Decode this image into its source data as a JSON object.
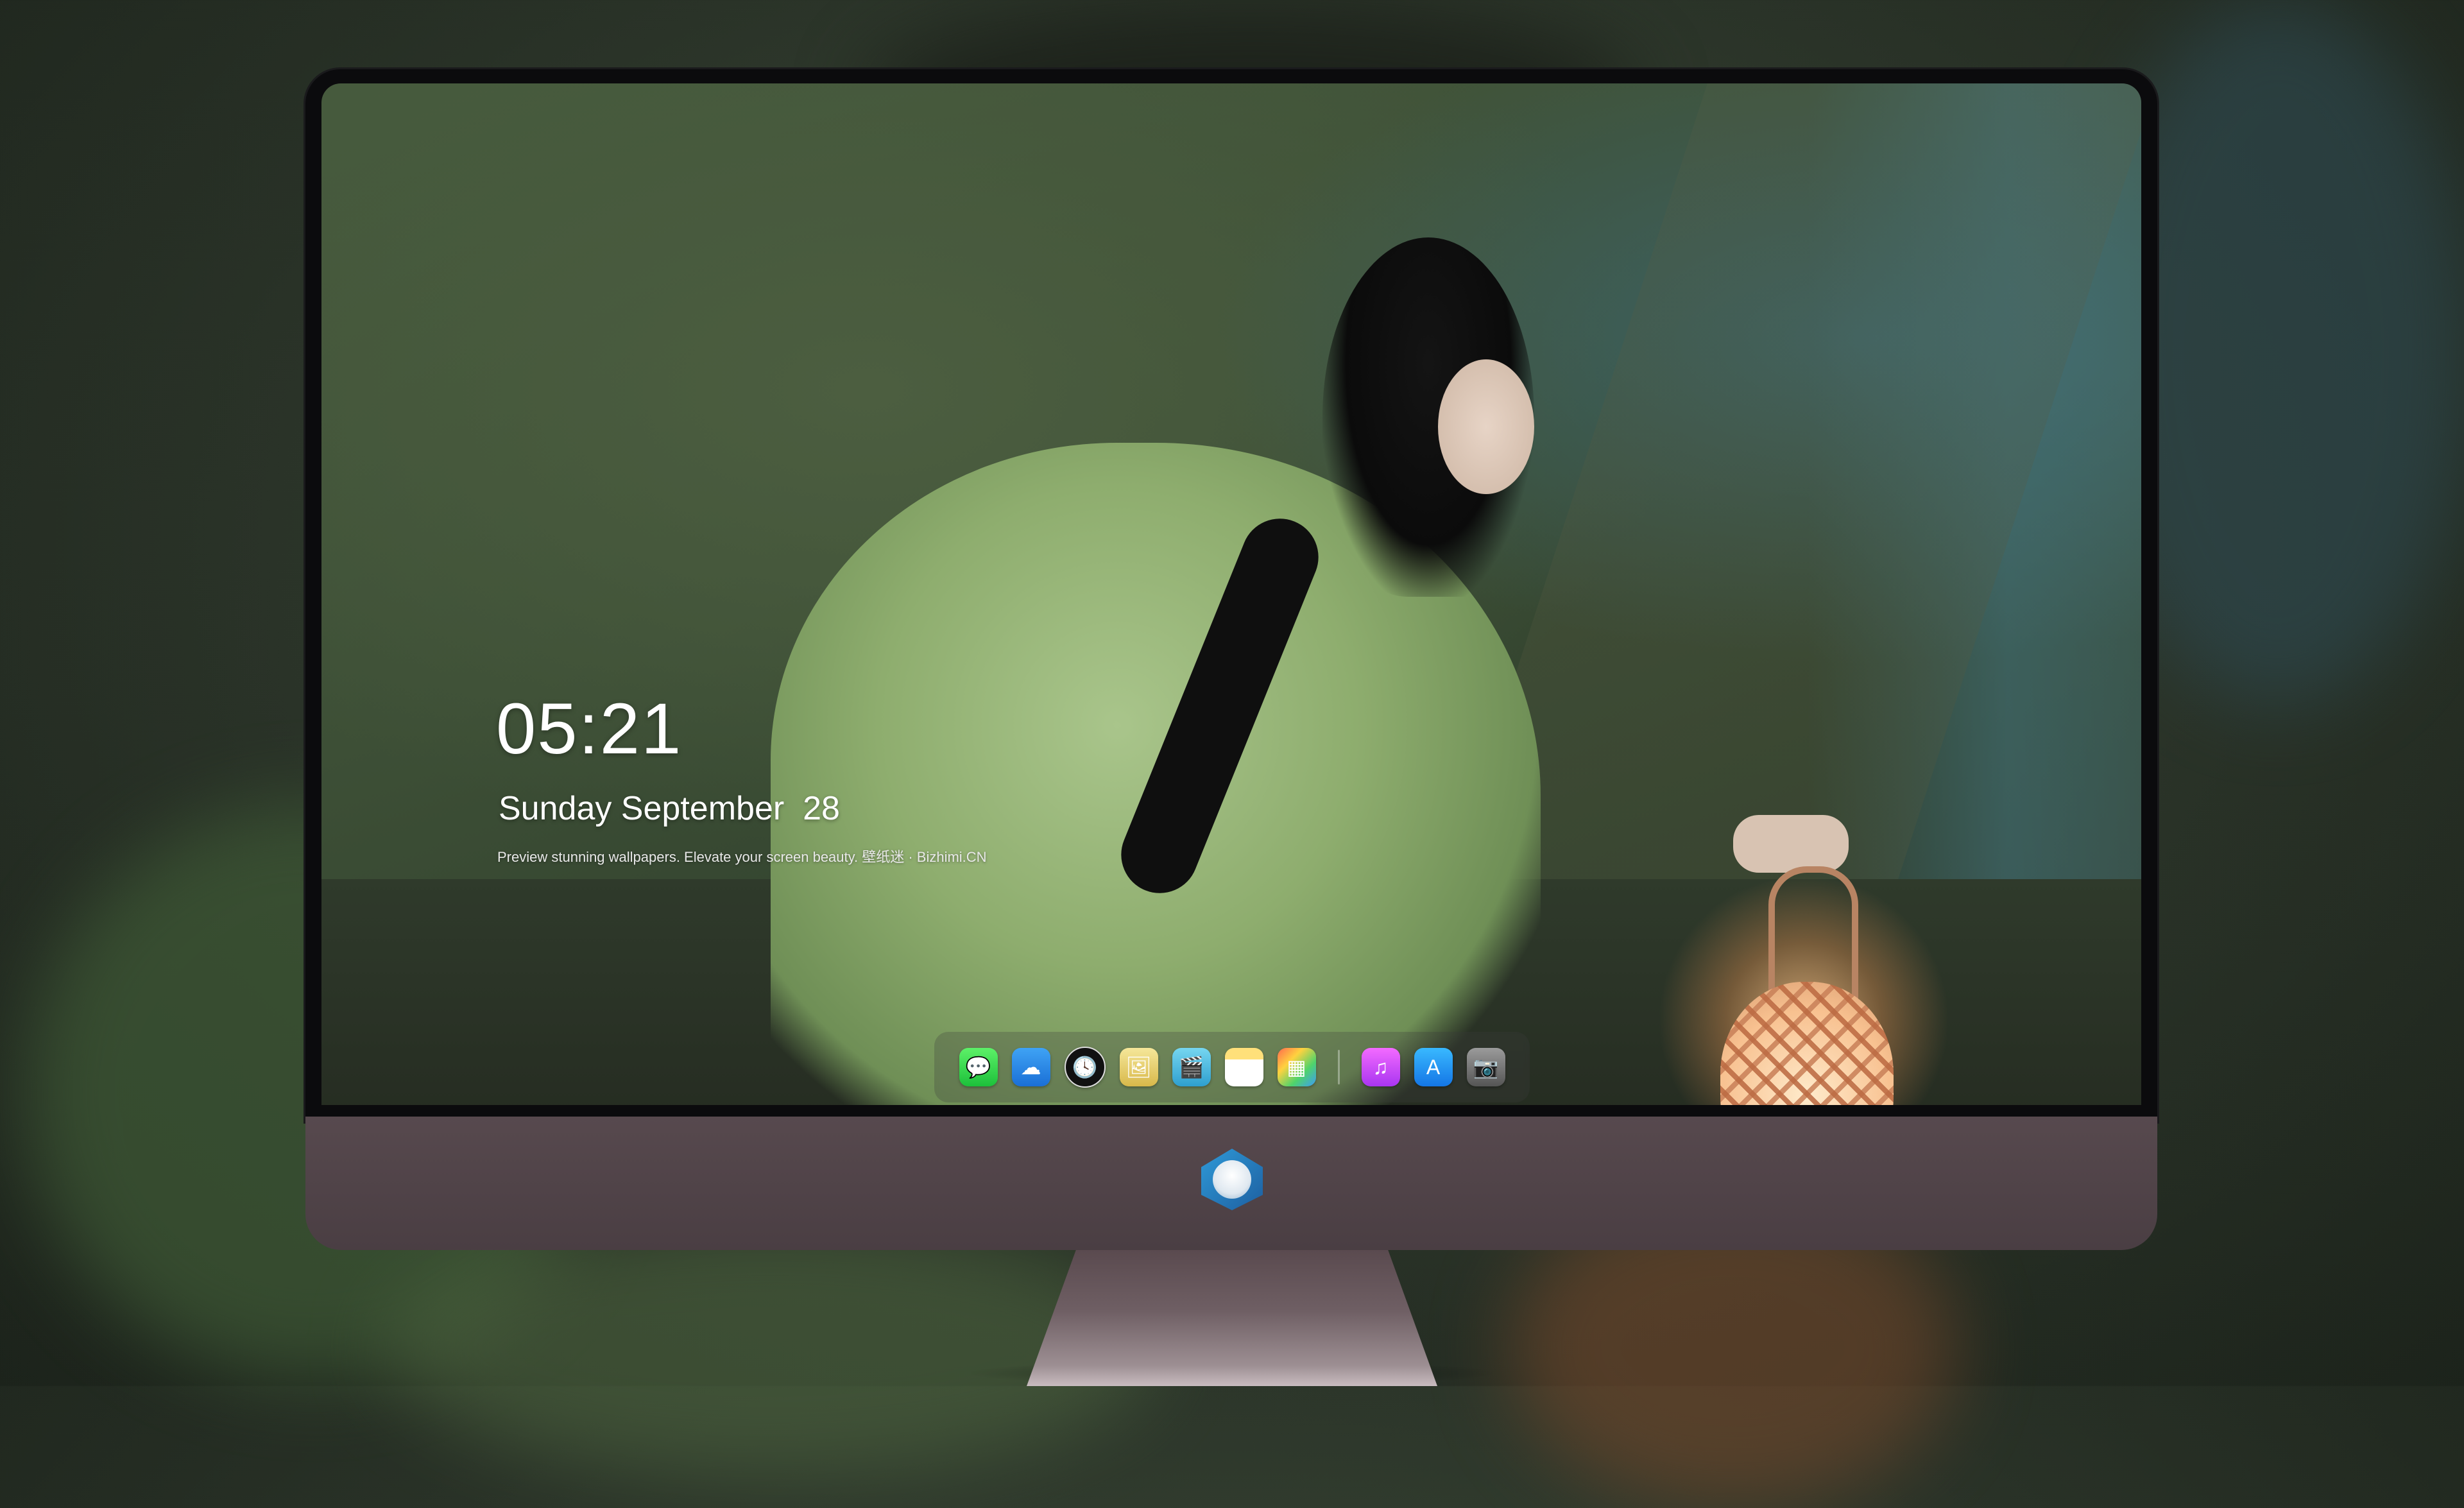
{
  "lock_screen": {
    "time": "05:21",
    "date": "Sunday September  28",
    "tagline": "Preview stunning wallpapers. Elevate your screen beauty. 壁纸迷 · Bizhimi.CN"
  },
  "dock": {
    "apps": [
      {
        "name": "messages-icon",
        "glyph": "💬"
      },
      {
        "name": "weather-icon",
        "glyph": "☁"
      },
      {
        "name": "clock-icon",
        "glyph": "🕓"
      },
      {
        "name": "preview-icon",
        "glyph": "🖼"
      },
      {
        "name": "video-editor-icon",
        "glyph": "🎬"
      },
      {
        "name": "notes-icon",
        "glyph": ""
      },
      {
        "name": "photos-icon",
        "glyph": "▦"
      },
      {
        "name": "music-icon",
        "glyph": "♫"
      },
      {
        "name": "app-store-icon",
        "glyph": "A"
      },
      {
        "name": "camera-icon",
        "glyph": "📷"
      }
    ]
  },
  "colors": {
    "dock_background": "#3c3c3c",
    "chin": "#4f4247",
    "text": "#ffffff"
  }
}
